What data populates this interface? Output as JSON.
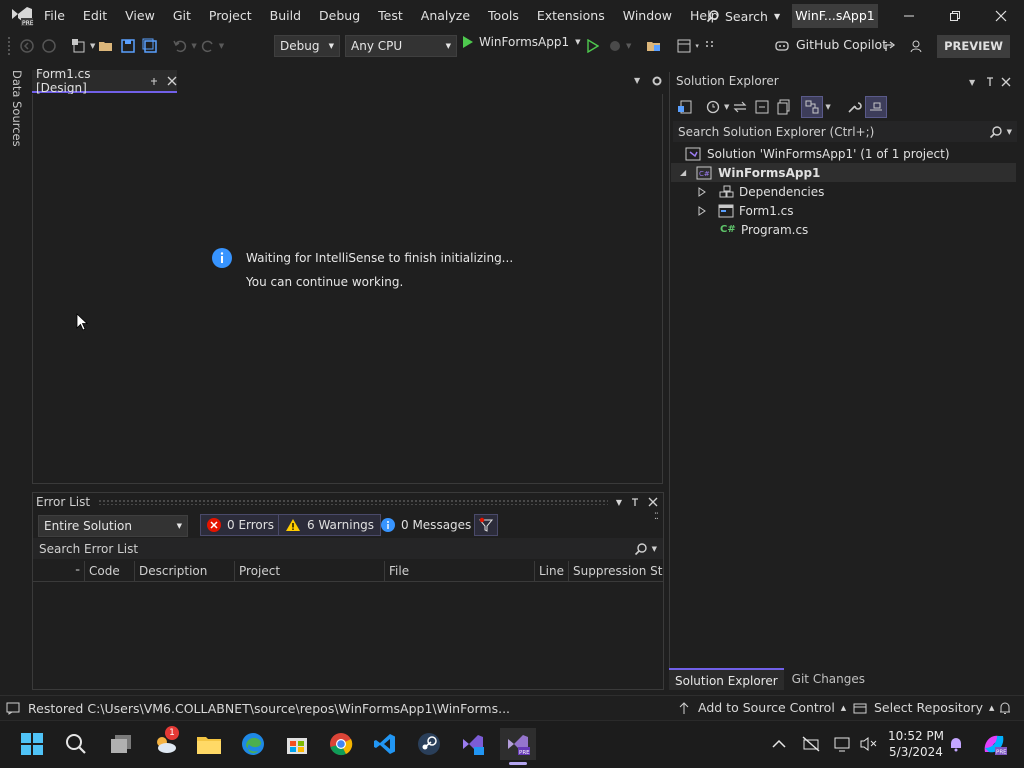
{
  "app": {
    "title_badge": "WinF...sApp1"
  },
  "menu": {
    "items": [
      "File",
      "Edit",
      "View",
      "Git",
      "Project",
      "Build",
      "Debug",
      "Test",
      "Analyze",
      "Tools",
      "Extensions",
      "Window",
      "Help"
    ],
    "search_label": "Search"
  },
  "toolbar": {
    "config": "Debug",
    "platform": "Any CPU",
    "run_target": "WinFormsApp1",
    "copilot_label": "GitHub Copilot",
    "preview_label": "PREVIEW"
  },
  "side_rail": {
    "label": "Data Sources"
  },
  "document": {
    "tab_label": "Form1.cs [Design]",
    "info_line1": "Waiting for IntelliSense to finish initializing...",
    "info_line2": "You can continue working."
  },
  "error_list": {
    "title": "Error List",
    "scope": "Entire Solution",
    "errors": "0 Errors",
    "warnings": "6 Warnings",
    "messages": "0 Messages",
    "search_placeholder": "Search Error List",
    "columns": [
      "Code",
      "Description",
      "Project",
      "File",
      "Line",
      "Suppression State"
    ]
  },
  "solution_explorer": {
    "title": "Solution Explorer",
    "search_placeholder": "Search Solution Explorer (Ctrl+;)",
    "solution_label": "Solution 'WinFormsApp1' (1 of 1 project)",
    "project_label": "WinFormsApp1",
    "nodes": [
      "Dependencies",
      "Form1.cs",
      "Program.cs"
    ],
    "tabs": [
      "Solution Explorer",
      "Git Changes"
    ]
  },
  "status": {
    "message": "Restored C:\\Users\\VM6.COLLABNET\\source\\repos\\WinFormsApp1\\WinForms...",
    "add_source": "Add to Source Control",
    "select_repo": "Select Repository"
  },
  "taskbar": {
    "time": "10:52 PM",
    "date": "5/3/2024",
    "weather_badge": "1"
  },
  "colors": {
    "accent": "#7160e8",
    "info_blue": "#3794ff",
    "error_red": "#e51400",
    "warning_yellow": "#ffcc00",
    "run_green": "#4ec94e"
  }
}
